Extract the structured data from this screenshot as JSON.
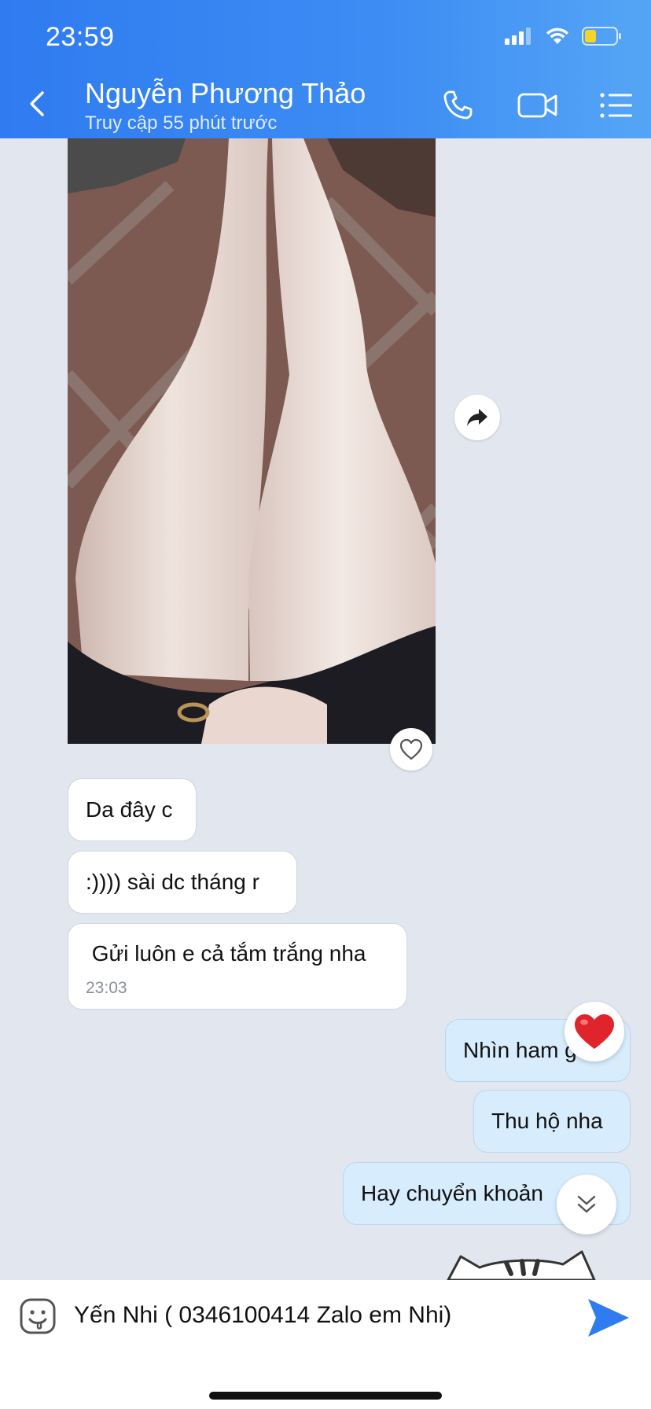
{
  "status_bar": {
    "time": "23:59"
  },
  "header": {
    "contact_name": "Nguyễn Phương Thảo",
    "last_seen": "Truy cập 55 phút trước",
    "icons": [
      "back-icon",
      "phone-icon",
      "video-call-icon",
      "menu-list-icon"
    ]
  },
  "messages": [
    {
      "direction": "incoming",
      "type": "image"
    },
    {
      "direction": "incoming",
      "text": "Da đây c"
    },
    {
      "direction": "incoming",
      "text": ":)))) sài dc tháng r"
    },
    {
      "direction": "incoming",
      "text": " Gửi luôn e cả tắm trắng nha",
      "time": "23:03"
    },
    {
      "direction": "outgoing",
      "text": "Nhìn ham g"
    },
    {
      "direction": "outgoing",
      "text": "Thu hộ nha"
    },
    {
      "direction": "outgoing",
      "text": "Hay chuyển khoản"
    }
  ],
  "composer": {
    "text": "Yến Nhi ( 0346100414 Zalo em Nhi)"
  },
  "colors": {
    "header_gradient_start": "#2f7bf0",
    "header_gradient_end": "#55a5f6",
    "outgoing_bubble": "#d7ecfc",
    "incoming_bubble": "#ffffff",
    "chat_background": "#e2e7ef",
    "send_icon": "#2f7bf0",
    "reaction_heart": "#e0242b",
    "battery_fill": "#f5d327"
  }
}
